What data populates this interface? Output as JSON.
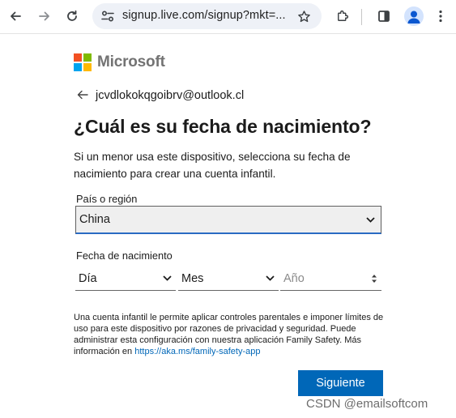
{
  "browser": {
    "url": "signup.live.com/signup?mkt=...",
    "icons": {
      "back": "arrow-left-icon",
      "forward": "arrow-right-icon",
      "reload": "reload-icon",
      "site_info": "tune-icon",
      "bookmark": "star-icon",
      "extensions": "puzzle-icon",
      "side_panel": "side-panel-icon",
      "profile": "person-icon",
      "menu": "kebab-menu-icon"
    }
  },
  "brand": {
    "name": "Microsoft",
    "colors": [
      "#f25022",
      "#7fba00",
      "#00a4ef",
      "#ffb900"
    ]
  },
  "account": {
    "email": "jcvdlokokqgoibrv@outlook.cl"
  },
  "heading": "¿Cuál es su fecha de nacimiento?",
  "description": "Si un menor usa este dispositivo, selecciona su fecha de nacimiento para crear una cuenta infantil.",
  "country": {
    "label": "País o región",
    "value": "China"
  },
  "birthdate": {
    "label": "Fecha de nacimiento",
    "day_value": "Día",
    "month_value": "Mes",
    "year_placeholder": "Año"
  },
  "disclaimer": {
    "text": "Una cuenta infantil le permite aplicar controles parentales e imponer límites de uso para este dispositivo por razones de privacidad y seguridad. Puede administrar esta configuración con nuestra aplicación Family Safety. Más información en ",
    "link": "https://aka.ms/family-safety-app"
  },
  "next_button": "Siguiente",
  "watermark": "CSDN @emailsoftcom",
  "colors": {
    "primary": "#0067b8",
    "focus_border": "#2a6bc3"
  }
}
